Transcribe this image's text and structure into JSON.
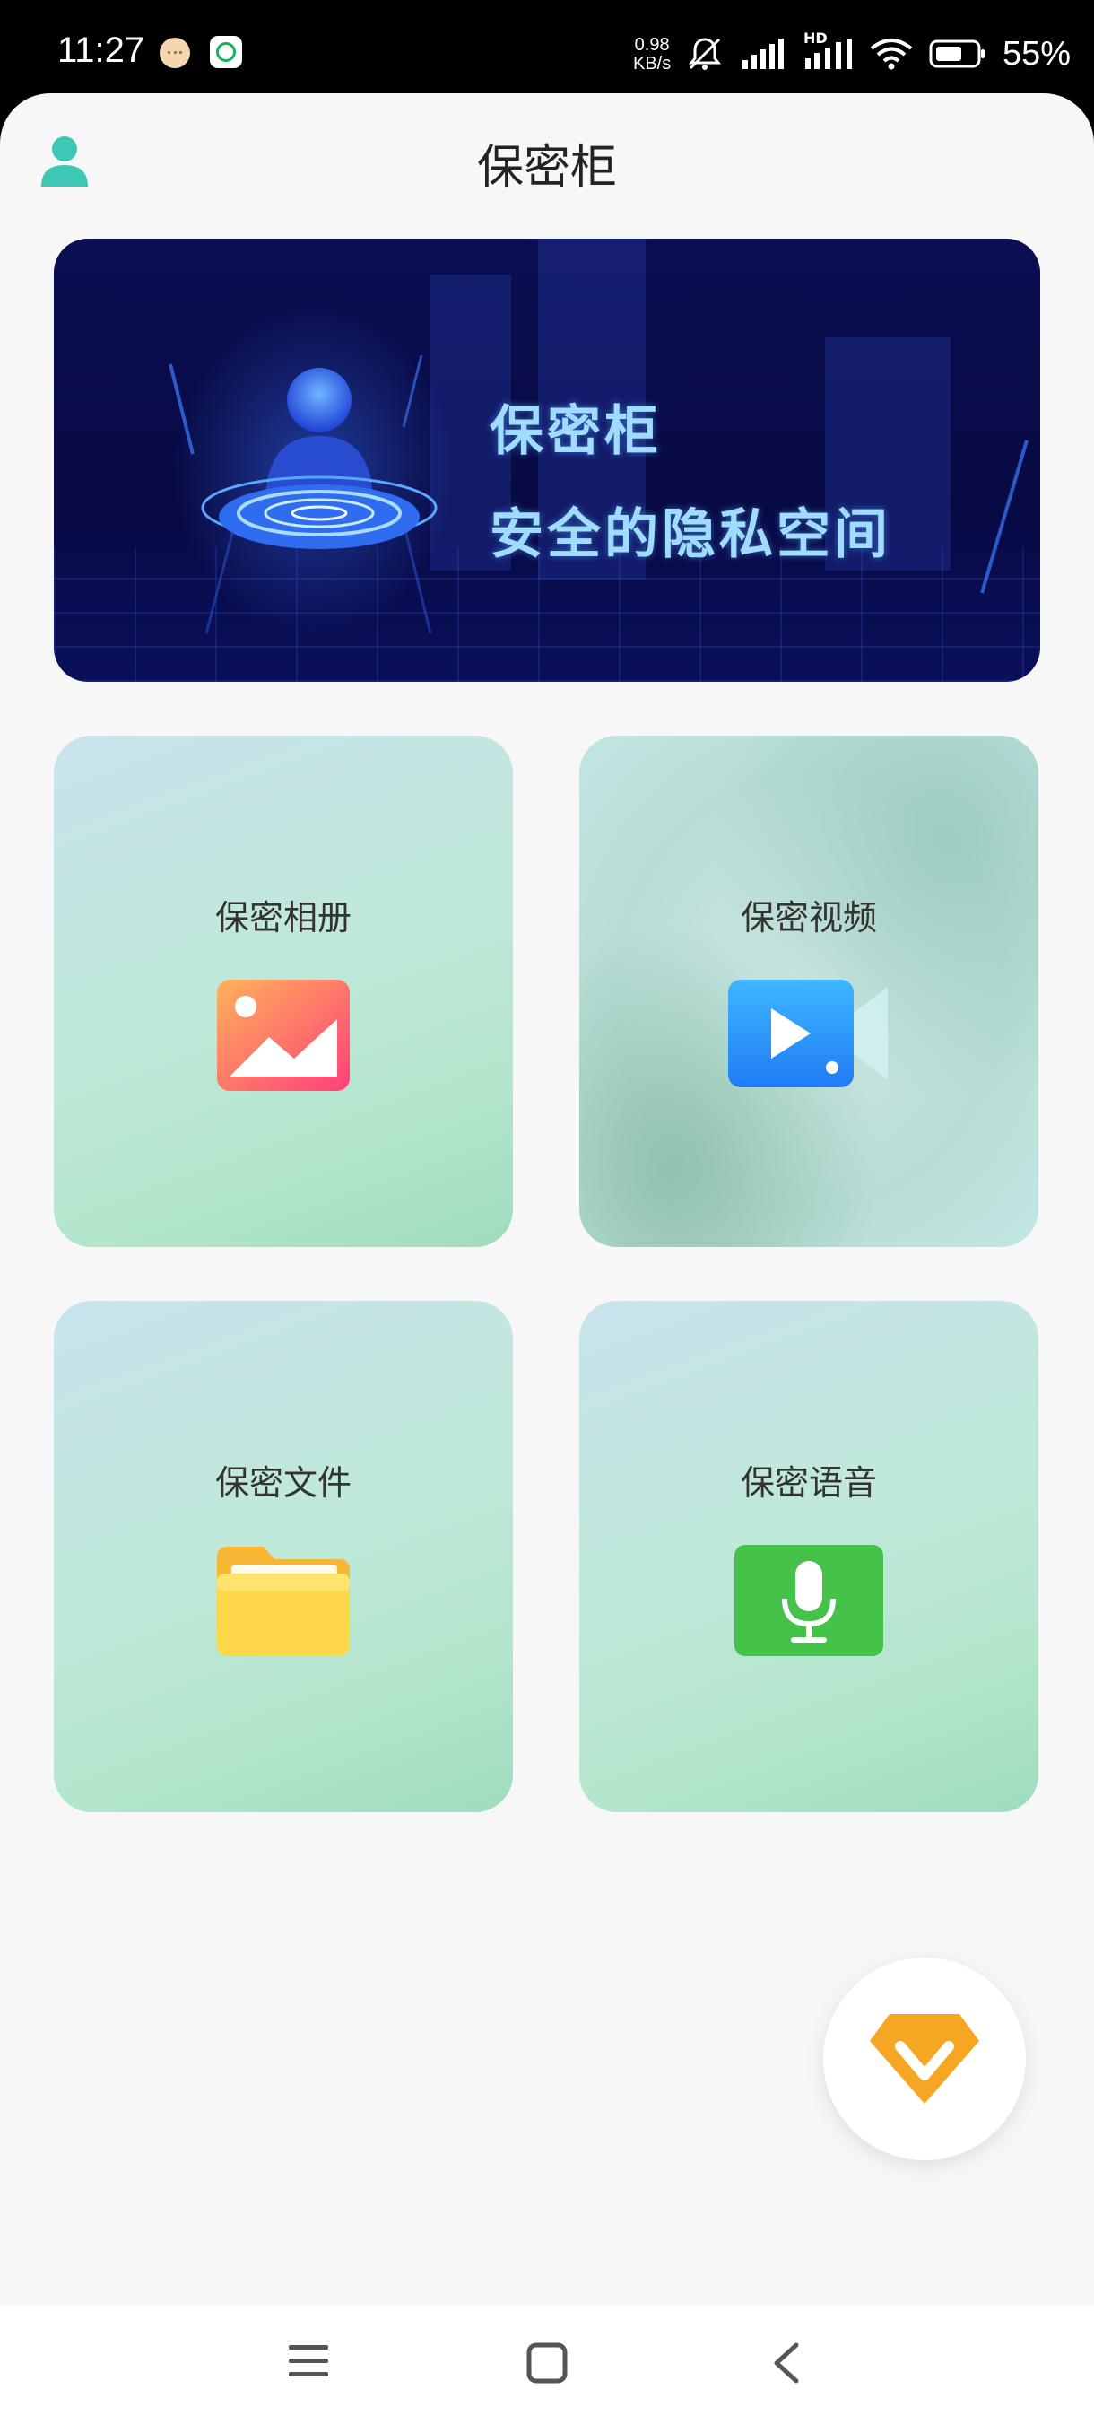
{
  "status_bar": {
    "time": "11:27",
    "net_speed_value": "0.98",
    "net_speed_unit": "KB/s",
    "network_type": "HD",
    "battery_percent": "55%",
    "icons": [
      "chat-bubble-icon",
      "app-icon",
      "bell-muted-icon",
      "signal-icon",
      "signal-hd-icon",
      "wifi-icon",
      "battery-icon"
    ]
  },
  "header": {
    "title": "保密柜",
    "avatar_icon": "user-icon"
  },
  "banner": {
    "line1": "保密柜",
    "line2": "安全的隐私空间"
  },
  "cards": [
    {
      "label": "保密相册",
      "icon": "photo-album-icon"
    },
    {
      "label": "保密视频",
      "icon": "video-camera-icon"
    },
    {
      "label": "保密文件",
      "icon": "folder-icon"
    },
    {
      "label": "保密语音",
      "icon": "microphone-icon"
    }
  ],
  "fab": {
    "icon": "vip-diamond-icon",
    "color": "#F5A623"
  },
  "nav": {
    "icons": [
      "menu-icon",
      "home-icon",
      "back-icon"
    ]
  },
  "colors": {
    "accent_teal": "#3CC8B4",
    "banner_bg": "#0A0E4E",
    "banner_text": "#9FDCFF"
  }
}
